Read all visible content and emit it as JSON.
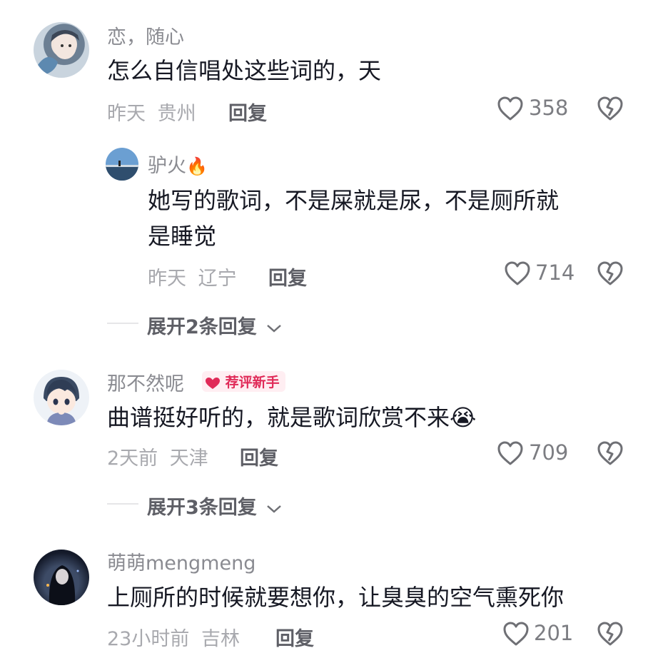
{
  "comments": [
    {
      "username": "恋，随心",
      "text": "怎么自信唱处这些词的，天",
      "time": "昨天",
      "location": "贵州",
      "reply_label": "回复",
      "likes": "358",
      "replies": [
        {
          "username": "驴火",
          "name_emoji": "🔥",
          "text_line1": "她写的歌词，不是屎就是尿，不是厕所就",
          "text_line2": "是睡觉",
          "time": "昨天",
          "location": "辽宁",
          "reply_label": "回复",
          "likes": "714"
        }
      ],
      "expand_label": "展开2条回复"
    },
    {
      "username": "那不然呢",
      "badge": "荐评新手",
      "text": "曲谱挺好听的，就是歌词欣赏不来",
      "text_emoji": "😭",
      "time": "2天前",
      "location": "天津",
      "reply_label": "回复",
      "likes": "709",
      "expand_label": "展开3条回复"
    },
    {
      "username": "萌萌mengmeng",
      "text": "上厕所的时候就要想你，让臭臭的空气熏死你",
      "time": "23小时前",
      "location": "吉林",
      "reply_label": "回复",
      "likes": "201"
    }
  ],
  "colors": {
    "text": "#161823",
    "secondary": "#8a8b91",
    "badge": "#e02a58"
  },
  "icons": [
    "heart-outline-icon",
    "broken-heart-icon",
    "chevron-down-icon",
    "fire-emoji",
    "crying-emoji",
    "badge-heart-icon"
  ]
}
